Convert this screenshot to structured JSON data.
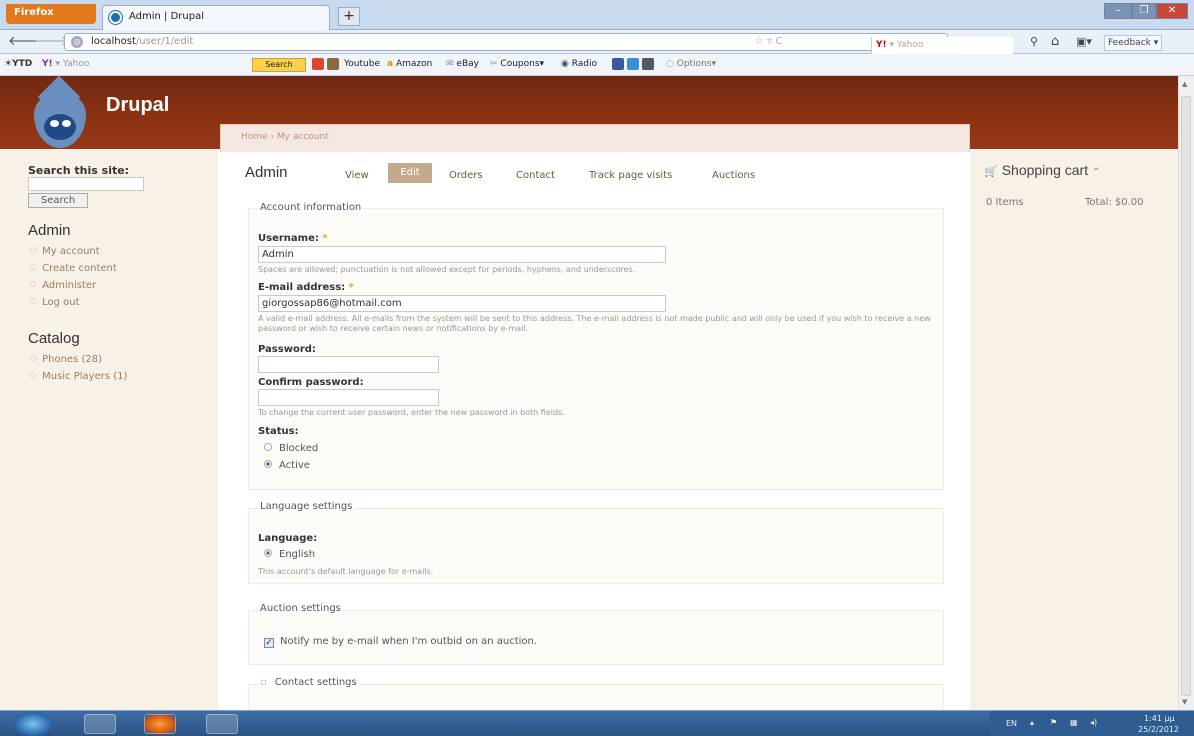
{
  "browser": {
    "app_button": "Firefox",
    "tab_title": "Admin | Drupal",
    "new_tab": "+",
    "url_host": "localhost",
    "url_path": "/user/1/edit",
    "search_placeholder": "Yahoo",
    "feedback": "Feedback"
  },
  "toolbar2": {
    "ytd": "YTD",
    "yahoo": "Yahoo",
    "search_btn": "Search",
    "items": [
      "Youtube",
      "Amazon",
      "eBay",
      "Coupons",
      "Radio",
      "Options"
    ]
  },
  "site": {
    "name": "Drupal",
    "breadcrumb": "Home › My account"
  },
  "sidebar": {
    "search_label": "Search this site:",
    "search_button": "Search",
    "admin_heading": "Admin",
    "admin_links": [
      "My account",
      "Create content",
      "Administer",
      "Log out"
    ],
    "catalog_heading": "Catalog",
    "catalog_links": [
      "Phones (28)",
      "Music Players (1)"
    ]
  },
  "main": {
    "title": "Admin",
    "tabs": [
      "View",
      "Edit",
      "Orders",
      "Contact",
      "Track page visits",
      "Auctions"
    ],
    "account_legend": "Account information",
    "username_label": "Username:",
    "username_value": "Admin",
    "username_desc": "Spaces are allowed; punctuation is not allowed except for periods, hyphens, and underscores.",
    "email_label": "E-mail address:",
    "email_value": "giorgossap86@hotmail.com",
    "email_desc": "A valid e-mail address. All e-mails from the system will be sent to this address. The e-mail address is not made public and will only be used if you wish to receive a new password or wish to receive certain news or notifications by e-mail.",
    "password_label": "Password:",
    "confirm_label": "Confirm password:",
    "password_desc": "To change the current user password, enter the new password in both fields.",
    "status_label": "Status:",
    "status_blocked": "Blocked",
    "status_active": "Active",
    "required_mark": "*",
    "language_legend": "Language settings",
    "language_label": "Language:",
    "language_value": "English",
    "language_desc": "This account's default language for e-mails.",
    "auction_legend": "Auction settings",
    "auction_checkbox": "Notify me by e-mail when I'm outbid on an auction.",
    "contact_legend": "Contact settings"
  },
  "cart": {
    "title": "Shopping cart",
    "items": "0 Items",
    "total": "Total: $0.00"
  },
  "taskbar": {
    "lang": "EN",
    "time": "1:41 μμ",
    "date": "25/2/2012"
  }
}
